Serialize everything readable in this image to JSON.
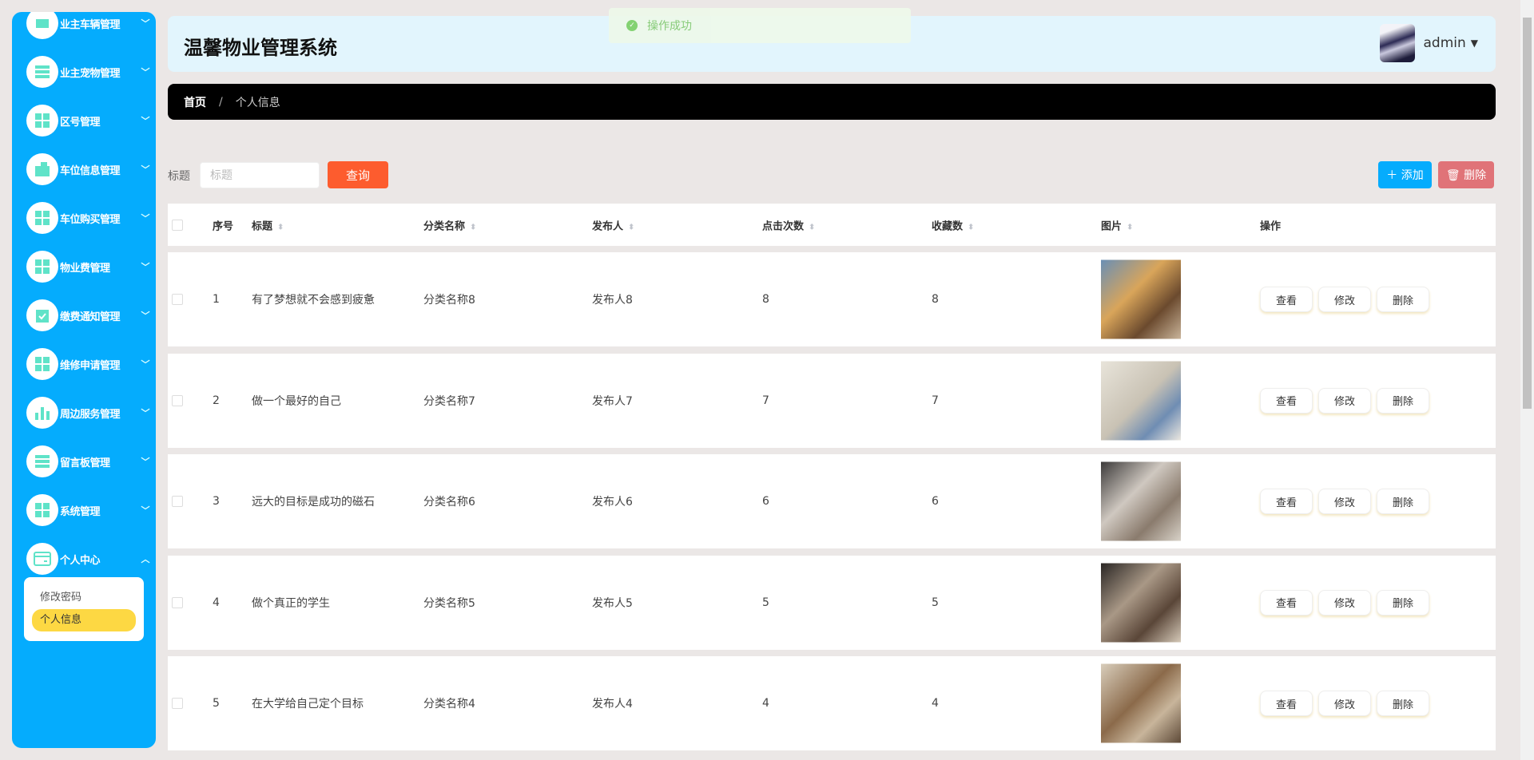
{
  "sidebar": {
    "items": [
      {
        "label": "业主车辆管理",
        "icon": "car-icon"
      },
      {
        "label": "业主宠物管理",
        "icon": "list-icon"
      },
      {
        "label": "区号管理",
        "icon": "grid-icon"
      },
      {
        "label": "车位信息管理",
        "icon": "wallet-icon"
      },
      {
        "label": "车位购买管理",
        "icon": "grid-icon"
      },
      {
        "label": "物业费管理",
        "icon": "grid-icon"
      },
      {
        "label": "缴费通知管理",
        "icon": "clipboard-check-icon"
      },
      {
        "label": "维修申请管理",
        "icon": "grid-icon"
      },
      {
        "label": "周边服务管理",
        "icon": "bar-chart-icon"
      },
      {
        "label": "留言板管理",
        "icon": "list-icon"
      },
      {
        "label": "系统管理",
        "icon": "grid-icon"
      },
      {
        "label": "个人中心",
        "icon": "card-icon"
      }
    ],
    "submenu": [
      "修改密码",
      "个人信息"
    ]
  },
  "header": {
    "title": "温馨物业管理系统",
    "username": "admin"
  },
  "toast": "操作成功",
  "breadcrumb": {
    "home": "首页",
    "sep": "/",
    "current": "个人信息"
  },
  "search": {
    "label": "标题",
    "placeholder": "标题",
    "query": "查询",
    "add": "添加",
    "delete": "删除"
  },
  "table": {
    "headers": [
      "序号",
      "标题",
      "分类名称",
      "发布人",
      "点击次数",
      "收藏数",
      "图片",
      "操作"
    ],
    "actions": [
      "查看",
      "修改",
      "删除"
    ],
    "rows": [
      [
        "1",
        "有了梦想就不会感到疲惫",
        "分类名称8",
        "发布人8",
        "8",
        "8"
      ],
      [
        "2",
        "做一个最好的自己",
        "分类名称7",
        "发布人7",
        "7",
        "7"
      ],
      [
        "3",
        "远大的目标是成功的磁石",
        "分类名称6",
        "发布人6",
        "6",
        "6"
      ],
      [
        "4",
        "做个真正的学生",
        "分类名称5",
        "发布人5",
        "5",
        "5"
      ],
      [
        "5",
        "在大学给自己定个目标",
        "分类名称4",
        "发布人4",
        "4",
        "4"
      ]
    ]
  },
  "colors": {
    "sidebar": "#05acfd",
    "accent": "#fd5c2e",
    "active": "#fdd843",
    "danger": "#e07378"
  }
}
